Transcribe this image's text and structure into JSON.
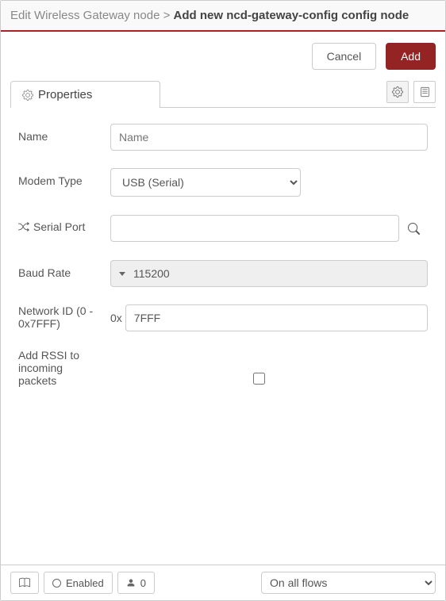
{
  "breadcrumb": {
    "parent": "Edit Wireless Gateway node",
    "separator": ">",
    "current": "Add new ncd-gateway-config config node"
  },
  "actions": {
    "cancel": "Cancel",
    "add": "Add"
  },
  "tabs": {
    "properties": "Properties"
  },
  "form": {
    "name": {
      "label": "Name",
      "placeholder": "Name",
      "value": ""
    },
    "modem_type": {
      "label": "Modem Type",
      "value": "USB (Serial)"
    },
    "serial_port": {
      "label": "Serial Port",
      "value": ""
    },
    "baud_rate": {
      "label": "Baud Rate",
      "value": "115200"
    },
    "network_id": {
      "label": "Network ID (0 - 0x7FFF)",
      "prefix": "0x",
      "value": "7FFF"
    },
    "add_rssi": {
      "label": "Add RSSI to incoming packets",
      "checked": false
    }
  },
  "footer": {
    "enabled_label": "Enabled",
    "user_count": "0",
    "scope_value": "On all flows"
  }
}
